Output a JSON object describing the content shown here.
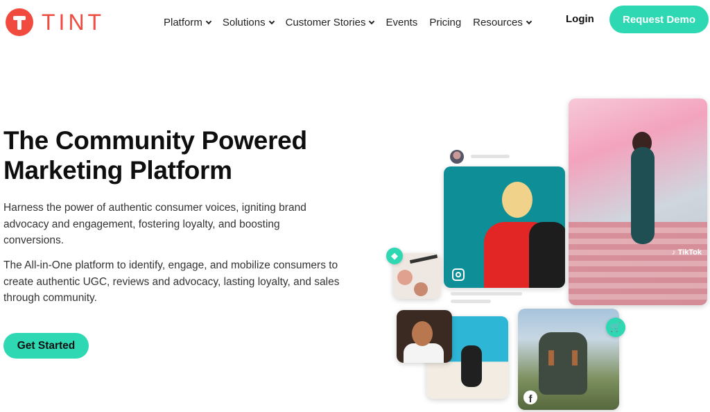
{
  "brand": {
    "name": "TINT",
    "color": "#f04b3e"
  },
  "nav": {
    "items": [
      {
        "label": "Platform",
        "dropdown": true
      },
      {
        "label": "Solutions",
        "dropdown": true
      },
      {
        "label": "Customer Stories",
        "dropdown": true
      },
      {
        "label": "Events",
        "dropdown": false
      },
      {
        "label": "Pricing",
        "dropdown": false
      },
      {
        "label": "Resources",
        "dropdown": true
      }
    ],
    "login": "Login",
    "demo": "Request Demo"
  },
  "hero": {
    "title": "The Community Powered Marketing Platform",
    "p1": "Harness the power of authentic consumer voices, igniting brand advocacy and engagement, fostering loyalty, and boosting conversions.",
    "p2": "The All-in-One platform to identify, engage, and mobilize consumers to create authentic UGC, reviews and advocacy, lasting loyalty, and sales through community.",
    "cta": "Get Started"
  },
  "collage": {
    "tiktok_label": "TikTok",
    "icons": [
      "instagram-icon",
      "tiktok-icon",
      "facebook-icon",
      "tag-icon",
      "cart-icon"
    ]
  },
  "colors": {
    "accent": "#2ed8b3",
    "brand": "#f04b3e"
  }
}
